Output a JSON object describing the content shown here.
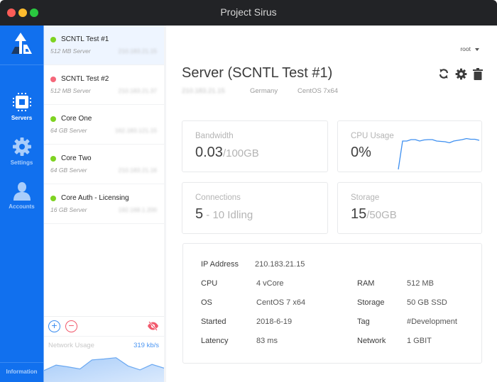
{
  "window": {
    "title": "Project Sirus",
    "controls": [
      "close",
      "minimize",
      "maximize"
    ]
  },
  "nav": {
    "logo": "project-sirus-logo",
    "items": [
      {
        "label": "Servers",
        "icon": "chip-icon",
        "active": true
      },
      {
        "label": "Settings",
        "icon": "gear-icon",
        "active": false
      },
      {
        "label": "Accounts",
        "icon": "user-icon",
        "active": false
      }
    ],
    "footer_label": "Information"
  },
  "servers": [
    {
      "name": "SCNTL Test #1",
      "spec": "512 MB Server",
      "ip": "210.183.21.15",
      "status": "online",
      "status_color": "#7ed321",
      "selected": true
    },
    {
      "name": "SCNTL Test #2",
      "spec": "512 MB Server",
      "ip": "210.183.21.37",
      "status": "offline",
      "status_color": "#f5677a",
      "selected": false
    },
    {
      "name": "Core One",
      "spec": "64 GB Server",
      "ip": "162.183.121.15",
      "status": "online",
      "status_color": "#7ed321",
      "selected": false
    },
    {
      "name": "Core Two",
      "spec": "64 GB Server",
      "ip": "210.183.21.16",
      "status": "online",
      "status_color": "#7ed321",
      "selected": false
    },
    {
      "name": "Core Auth - Licensing",
      "spec": "16 GB Server",
      "ip": "192.168.1.200",
      "status": "online",
      "status_color": "#7ed321",
      "selected": false
    }
  ],
  "list_toolbar": {
    "add_icon": "plus-circle-icon",
    "remove_icon": "minus-circle-icon",
    "hide_icon": "eye-slash-icon",
    "add_symbol": "+",
    "remove_symbol": "−"
  },
  "network_usage": {
    "label": "Network Usage",
    "value": "319 kb/s",
    "series": [
      40,
      58,
      52,
      45,
      75,
      78,
      82,
      55,
      42,
      60,
      48
    ]
  },
  "header": {
    "user": "root",
    "title": "Server (SCNTL Test #1)",
    "ip": "210.183.21.15",
    "country": "Germany",
    "os": "CentOS 7x64",
    "actions": [
      "refresh-icon",
      "gear-icon",
      "trash-icon"
    ]
  },
  "stats": {
    "bandwidth": {
      "label": "Bandwidth",
      "value": "0.03",
      "suffix": "/100GB"
    },
    "cpu": {
      "label": "CPU Usage",
      "value": "0%",
      "series": [
        0,
        80,
        80,
        84,
        84,
        80,
        83,
        84,
        84,
        80,
        79,
        78,
        75,
        80,
        82,
        84,
        87,
        85,
        85,
        82
      ]
    },
    "connections": {
      "label": "Connections",
      "value": "5",
      "suffix": " - 10 Idling"
    },
    "storage": {
      "label": "Storage",
      "value": "15",
      "suffix": "/50GB"
    }
  },
  "details": {
    "ip_label": "IP Address",
    "ip_value": "210.183.21.15",
    "cpu_label": "CPU",
    "cpu_value": "4  vCore",
    "ram_label": "RAM",
    "ram_value": "512 MB",
    "os_label": "OS",
    "os_value": "CentOS 7 x64",
    "storage_label": "Storage",
    "storage_value": "50 GB SSD",
    "started_label": "Started",
    "started_value": "2018-6-19",
    "tag_label": "Tag",
    "tag_value": "#Development",
    "latency_label": "Latency",
    "latency_value": "83 ms",
    "network_label": "Network",
    "network_value": "1 GBIT"
  }
}
